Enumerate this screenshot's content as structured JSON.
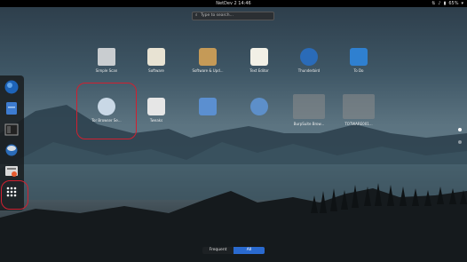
{
  "topbar": {
    "clock": "NetDev 2 14:46",
    "status_text": "65%"
  },
  "search": {
    "placeholder": "Type to search..."
  },
  "apps_row1": [
    {
      "label": "Simple Scan",
      "icon": "scanner-icon",
      "color": "#c9cdd0"
    },
    {
      "label": "Software",
      "icon": "software-center-icon",
      "color": "#e8e3d3"
    },
    {
      "label": "Software & Upd...",
      "icon": "package-icon",
      "color": "#c59a57"
    },
    {
      "label": "Text Editor",
      "icon": "text-editor-icon",
      "color": "#f2f0e6"
    },
    {
      "label": "Thunderbird",
      "icon": "thunderbird-icon",
      "color": "#2a6bb8"
    },
    {
      "label": "To Do",
      "icon": "todo-check-icon",
      "color": "#2f80d0"
    }
  ],
  "apps_row2": [
    {
      "label": "Tor Browser Se...",
      "icon": "tor-browser-icon",
      "color": "#c9d8e6"
    },
    {
      "label": "Tweaks",
      "icon": "tweaks-icon",
      "color": "#e6e6e6"
    },
    {
      "label": "",
      "icon": "server-icon",
      "color": "#5b8fd0"
    },
    {
      "label": "",
      "icon": "globe-icon",
      "color": "#5d8fc9"
    },
    {
      "label": "BurpSuite Brow...",
      "icon": "burp-folder-icon",
      "color": "#8a8a8a"
    },
    {
      "label": "TOTWARE001...",
      "icon": "app-folder-icon",
      "color": "#8a8a8a"
    }
  ],
  "dash": [
    {
      "name": "firefox",
      "icon": "firefox-icon"
    },
    {
      "name": "files",
      "icon": "files-icon"
    },
    {
      "name": "terminal",
      "icon": "terminal-icon"
    },
    {
      "name": "thunderbird",
      "icon": "thunderbird-icon"
    },
    {
      "name": "software",
      "icon": "software-icon"
    },
    {
      "name": "show-apps",
      "icon": "show-apps-grid-icon"
    }
  ],
  "tabs": [
    {
      "label": "Frequent",
      "active": false
    },
    {
      "label": "All",
      "active": true
    }
  ],
  "colors": {
    "accent": "#2a6ad0",
    "highlight": "#d02030"
  }
}
